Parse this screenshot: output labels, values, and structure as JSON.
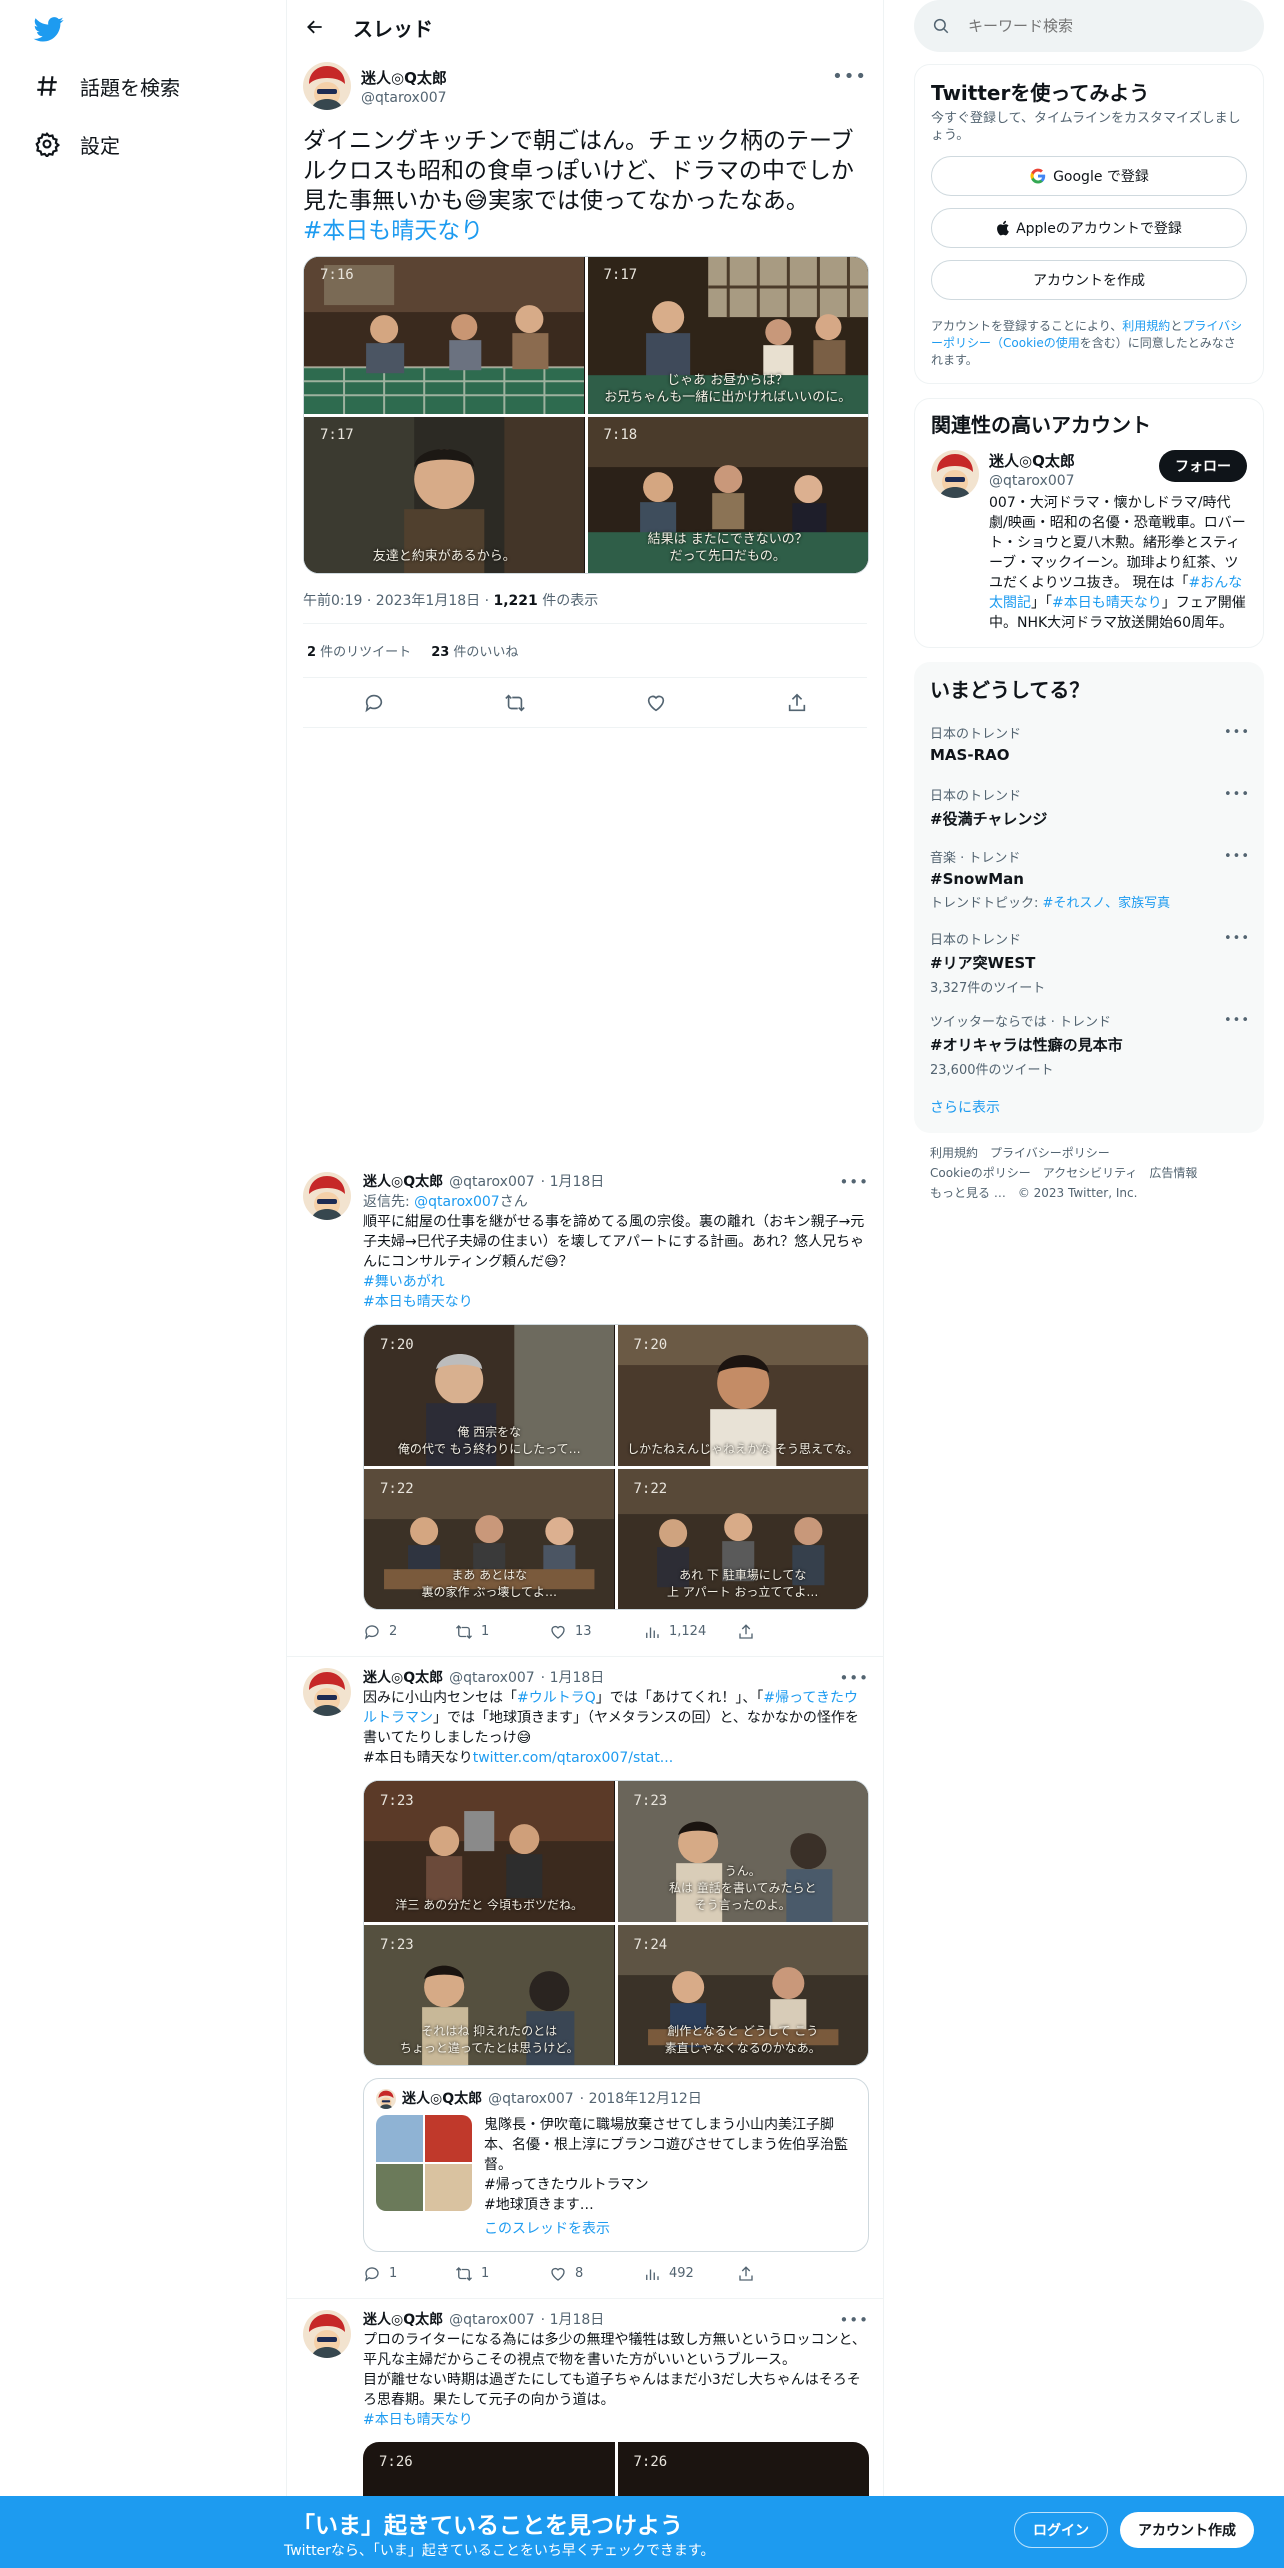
{
  "nav": {
    "explore_label": "話題を検索",
    "settings_label": "設定"
  },
  "header": {
    "title": "スレッド"
  },
  "main_tweet": {
    "display_name": "迷人◎Q太郎",
    "handle": "@qtarox007",
    "text": "ダイニングキッチンで朝ごはん。チェック柄のテーブルクロスも昭和の食卓っぽいけど、ドラマの中でしか見た事無いかも😅実家では使ってなかったなあ。",
    "hashtag": "#本日も晴天なり",
    "images": [
      {
        "time": "7:16",
        "subtitle": ""
      },
      {
        "time": "7:17",
        "subtitle": "じゃあ お昼からは？\nお兄ちゃんも一緒に出かければいいのに。"
      },
      {
        "time": "7:17",
        "subtitle": "友達と約束があるから。"
      },
      {
        "time": "7:18",
        "subtitle": "結果は またにできないの？\nだって先口だもの。"
      }
    ],
    "timestamp": "午前0:19 · 2023年1月18日 · ",
    "views_count": "1,221",
    "views_label": " 件の表示",
    "retweets_count": "2",
    "retweets_label": " 件のリツイート",
    "likes_count": "23",
    "likes_label": " 件のいいね"
  },
  "replies": [
    {
      "display_name": "迷人◎Q太郎",
      "handle": "@qtarox007",
      "date": "· 1月18日",
      "reply_to_label": "返信先: ",
      "reply_to_handle": "@qtarox007",
      "reply_to_suffix": "さん",
      "text": "順平に紺屋の仕事を継がせる事を諦めてる風の宗俊。裏の離れ（おキン親子→元子夫婦→巳代子夫婦の住まい）を壊してアパートにする計画。あれ？悠人兄ちゃんにコンサルティング頼んだ😅？",
      "hashtags": [
        "#舞いあがれ",
        "#本日も晴天なり"
      ],
      "images": [
        {
          "time": "7:20",
          "subtitle": "俺 西宗をな\n俺の代で もう終わりにしたって…"
        },
        {
          "time": "7:20",
          "subtitle": "しかたねえんじゃねえかな そう思えてな。"
        },
        {
          "time": "7:22",
          "subtitle": "まあ あとはな\n裏の家作 ぶっ壊してよ…"
        },
        {
          "time": "7:22",
          "subtitle": "あれ 下 駐車場にしてな\n上 アパート おっ立ててよ…"
        }
      ],
      "reply_count": "2",
      "retweet_count": "1",
      "like_count": "13",
      "view_count": "1,124"
    },
    {
      "display_name": "迷人◎Q太郎",
      "handle": "@qtarox007",
      "date": "· 1月18日",
      "text_1": "因みに小山内センセは「",
      "tag_1": "#ウルトラQ",
      "text_2": "」では「あけてくれ！」、「",
      "tag_2": "#帰ってきたウルトラマン",
      "text_3": "」では「地球頂きます」（ヤメタランスの回）と、なかなかの怪作を書いてたりしましたっけ😅",
      "text_4": "#本日も晴天なり",
      "url": "twitter.com/qtarox007/stat...",
      "images": [
        {
          "time": "7:23",
          "subtitle": "洋三 あの分だと 今頃もボツだね。"
        },
        {
          "time": "7:23",
          "subtitle": "うん。\n私は 童話を書いてみたらと\nそう言ったのよ。"
        },
        {
          "time": "7:23",
          "subtitle": "それはね 抑えれたのとは\nちょっと違ってたとは思うけど。"
        },
        {
          "time": "7:24",
          "subtitle": "創作となると どうして こう\n素直じゃなくなるのかなあ。"
        }
      ],
      "quote": {
        "display_name": "迷人◎Q太郎",
        "handle": "@qtarox007",
        "date": "· 2018年12月12日",
        "text": "鬼隊長・伊吹竜に職場放棄させてしまう小山内美江子脚本、名優・根上淳にブランコ遊びさせてしまう佐伯孚治監督。\n#帰ってきたウルトラマン\n#地球頂きます…",
        "show_thread": "このスレッドを表示"
      },
      "reply_count": "1",
      "retweet_count": "1",
      "like_count": "8",
      "view_count": "492"
    },
    {
      "display_name": "迷人◎Q太郎",
      "handle": "@qtarox007",
      "date": "· 1月18日",
      "text": "プロのライターになる為には多少の無理や犠牲は致し方無いというロッコンと、平凡な主婦だからこその視点で物を書いた方がいいというブルース。\n目が離せない時期は過ぎたにしても道子ちゃんはまだ小3だし大ちゃんはそろそろ思春期。果たして元子の向かう道は。",
      "hashtag": "#本日も晴天なり",
      "images": [
        {
          "time": "7:26",
          "subtitle": ""
        },
        {
          "time": "7:26",
          "subtitle": ""
        }
      ]
    }
  ],
  "search": {
    "placeholder": "キーワード検索"
  },
  "signup": {
    "title": "Twitterを使ってみよう",
    "subtitle": "今すぐ登録して、タイムラインをカスタマイズしましょう。",
    "google_label": "Google で登録",
    "apple_label": "Appleのアカウントで登録",
    "create_label": "アカウントを作成",
    "terms_1": "アカウントを登録することにより、",
    "terms_link_1": "利用規約",
    "terms_2": "と",
    "terms_link_2": "プライバシーポリシー（Cookieの使用",
    "terms_3": "を含む）に同意したとみなされます。"
  },
  "related": {
    "title": "関連性の高いアカウント",
    "display_name": "迷人◎Q太郎",
    "handle": "@qtarox007",
    "follow_label": "フォロー",
    "bio_1": "007・大河ドラマ・懐かしドラマ/時代劇/映画・昭和の名優・恐竜戦車。ロバート・ショウと夏八木勲。緒形拳とスティーブ・マックイーン。珈琲より紅茶、ツユだくよりツユ抜き。 現在は「",
    "bio_link_1": "#おんな太閤記",
    "bio_2": "」「",
    "bio_link_2": "#本日も晴天なり",
    "bio_3": "」フェア開催中。NHK大河ドラマ放送開始60周年。"
  },
  "trends": {
    "title": "いまどうしてる？",
    "items": [
      {
        "context": "日本のトレンド",
        "name": "MAS-RAO",
        "meta": ""
      },
      {
        "context": "日本のトレンド",
        "name": "#役満チャレンジ",
        "meta": ""
      },
      {
        "context": "音楽 · トレンド",
        "name": "#SnowMan",
        "meta": "トレンドトピック: ",
        "meta_link": "#それスノ、家族写真"
      },
      {
        "context": "日本のトレンド",
        "name": "#リア突WEST",
        "meta": "3,327件のツイート"
      },
      {
        "context": "ツイッターならでは · トレンド",
        "name": "#オリキャラは性癖の見本市",
        "meta": "23,600件のツイート"
      }
    ],
    "show_more": "さらに表示"
  },
  "footer": {
    "links": [
      "利用規約",
      "プライバシーポリシー",
      "Cookieのポリシー",
      "アクセシビリティ",
      "広告情報",
      "もっと見る …"
    ],
    "copyright": "© 2023 Twitter, Inc."
  },
  "bottom_bar": {
    "headline": "「いま」起きていることを見つけよう",
    "subtext": "Twitterなら、「いま」起きていることをいち早くチェックできます。",
    "login_label": "ログイン",
    "signup_label": "アカウント作成"
  },
  "colors": {
    "accent": "#1d9bf0",
    "text": "#0f1419",
    "muted": "#536471",
    "border": "#eff3f4"
  }
}
